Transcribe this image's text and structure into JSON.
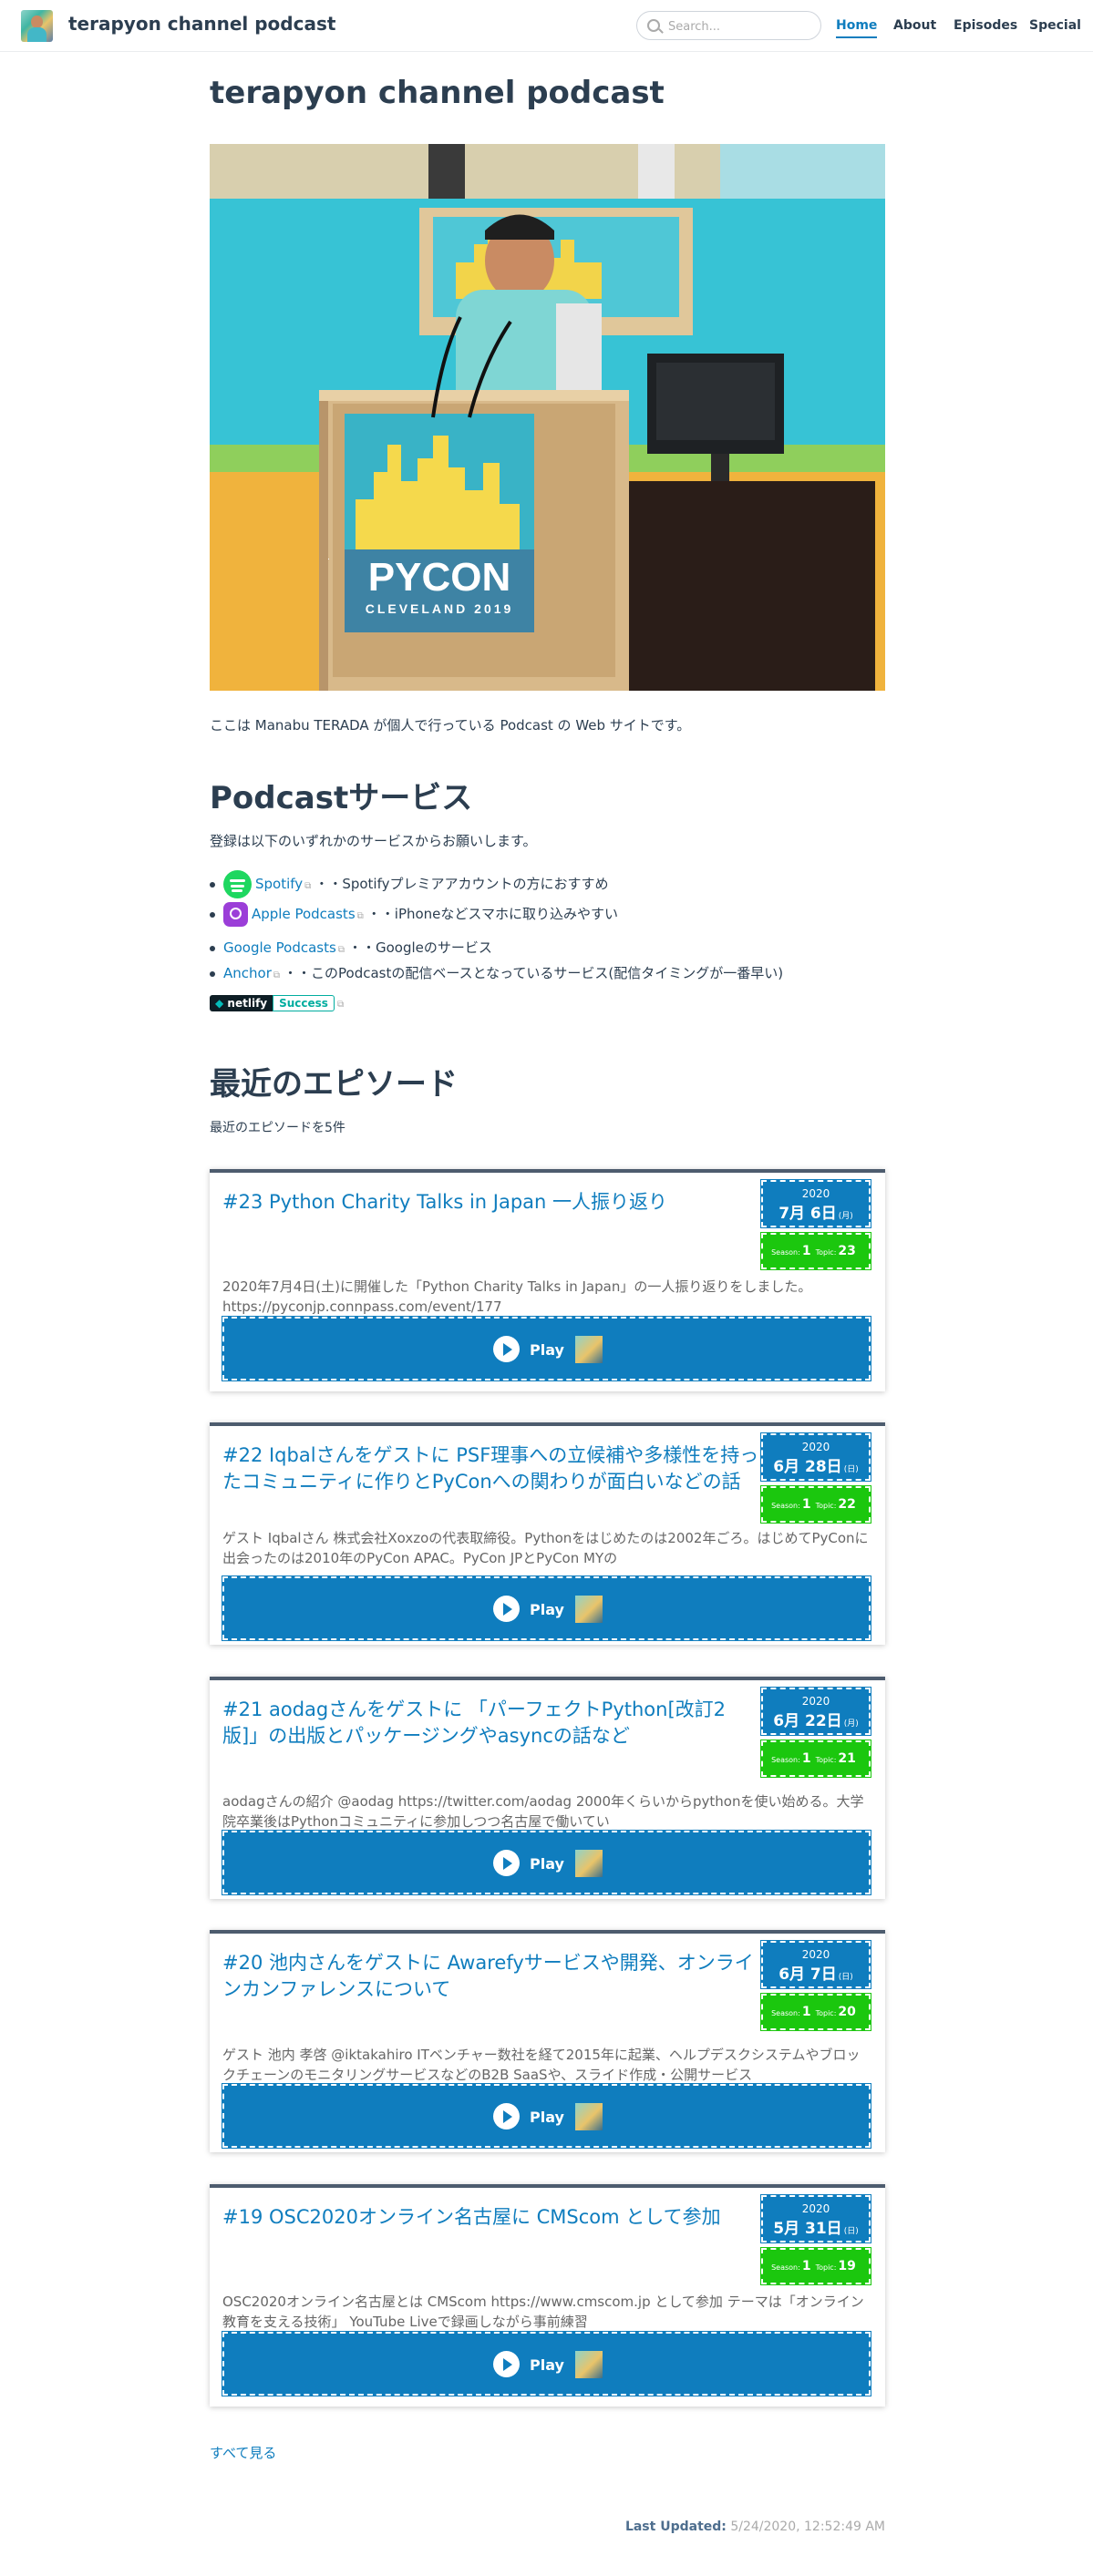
{
  "navbar": {
    "site_name": "terapyon channel podcast",
    "search_placeholder": "Search...",
    "links": [
      "Home",
      "About",
      "Episodes",
      "Special"
    ]
  },
  "page": {
    "title": "terapyon channel podcast",
    "intro": "ここは Manabu TERADA が個人で行っている Podcast の Web サイトです。",
    "hero_sign_top": "PYCON",
    "hero_sign_bottom": "CLEVELAND 2019"
  },
  "services": {
    "heading": "Podcastサービス",
    "lead": "登録は以下のいずれかのサービスからお願いします。",
    "items": [
      {
        "name": "Spotify",
        "note": "・・Spotifyプレミアアカウントの方におすすめ",
        "icon": "spotify-icon"
      },
      {
        "name": "Apple Podcasts",
        "note": "・・iPhoneなどスマホに取り込みやすい",
        "icon": "apple-podcasts-icon"
      },
      {
        "name": "Google Podcasts",
        "note": "・・Googleのサービス"
      },
      {
        "name": "Anchor",
        "note": "・・このPodcastの配信ベースとなっているサービス(配信タイミングが一番早い)"
      }
    ],
    "badge_left": "netlify",
    "badge_right": "Success"
  },
  "recent": {
    "heading": "最近のエピソード",
    "lead": "最近のエピソードを5件",
    "season_label": "Season:",
    "topic_label": "Topic:",
    "play_label": "Play",
    "episodes": [
      {
        "title": "#23 Python Charity Talks in Japan 一人振り返り",
        "year": "2020",
        "date": "7月 6日",
        "dow": "(月)",
        "season": "1",
        "topic": "23",
        "desc": "2020年7月4日(土)に開催した「Python Charity Talks in Japan」の一人振り返りをしました。 https://pyconjp.connpass.com/event/177"
      },
      {
        "title": "#22 Iqbalさんをゲストに PSF理事への立候補や多様性を持ったコミュニティに作りとPyConへの関わりが面白いなどの話",
        "year": "2020",
        "date": "6月 28日",
        "dow": "(日)",
        "season": "1",
        "topic": "22",
        "desc": "ゲスト Iqbalさん 株式会社Xoxzoの代表取締役。Pythonをはじめたのは2002年ごろ。はじめてPyConに出会ったのは2010年のPyCon APAC。PyCon JPとPyCon MYの"
      },
      {
        "title": "#21 aodagさんをゲストに 「パーフェクトPython[改訂2版]」の出版とパッケージングやasyncの話など",
        "year": "2020",
        "date": "6月 22日",
        "dow": "(月)",
        "season": "1",
        "topic": "21",
        "desc": "aodagさんの紹介 @aodag https://twitter.com/aodag 2000年くらいからpythonを使い始める。大学院卒業後はPythonコミュニティに参加しつつ名古屋で働いてい"
      },
      {
        "title": "#20 池内さんをゲストに Awarefyサービスや開発、オンラインカンファレンスについて",
        "year": "2020",
        "date": "6月 7日",
        "dow": "(日)",
        "season": "1",
        "topic": "20",
        "desc": "ゲスト 池内 孝啓 @iktakahiro ITベンチャー数社を経て2015年に起業、ヘルプデスクシステムやブロックチェーンのモニタリングサービスなどのB2B SaaSや、スライド作成・公開サービス"
      },
      {
        "title": "#19 OSC2020オンライン名古屋に CMScom として参加",
        "year": "2020",
        "date": "5月 31日",
        "dow": "(日)",
        "season": "1",
        "topic": "19",
        "desc": "OSC2020オンライン名古屋とは CMScom https://www.cmscom.jp として参加 テーマは「オンライン教育を支える技術」 YouTube Liveで録画しながら事前練習"
      }
    ],
    "see_all": "すべて見る"
  },
  "footer": {
    "updated_label": "Last Updated:",
    "updated_value": "5/24/2020, 12:52:49 AM"
  },
  "colors": {
    "accent": "#0f7dbe",
    "season_green": "#1bc70e",
    "spotify": "#1ed760",
    "apple_podcasts": "#9b3ed8"
  }
}
